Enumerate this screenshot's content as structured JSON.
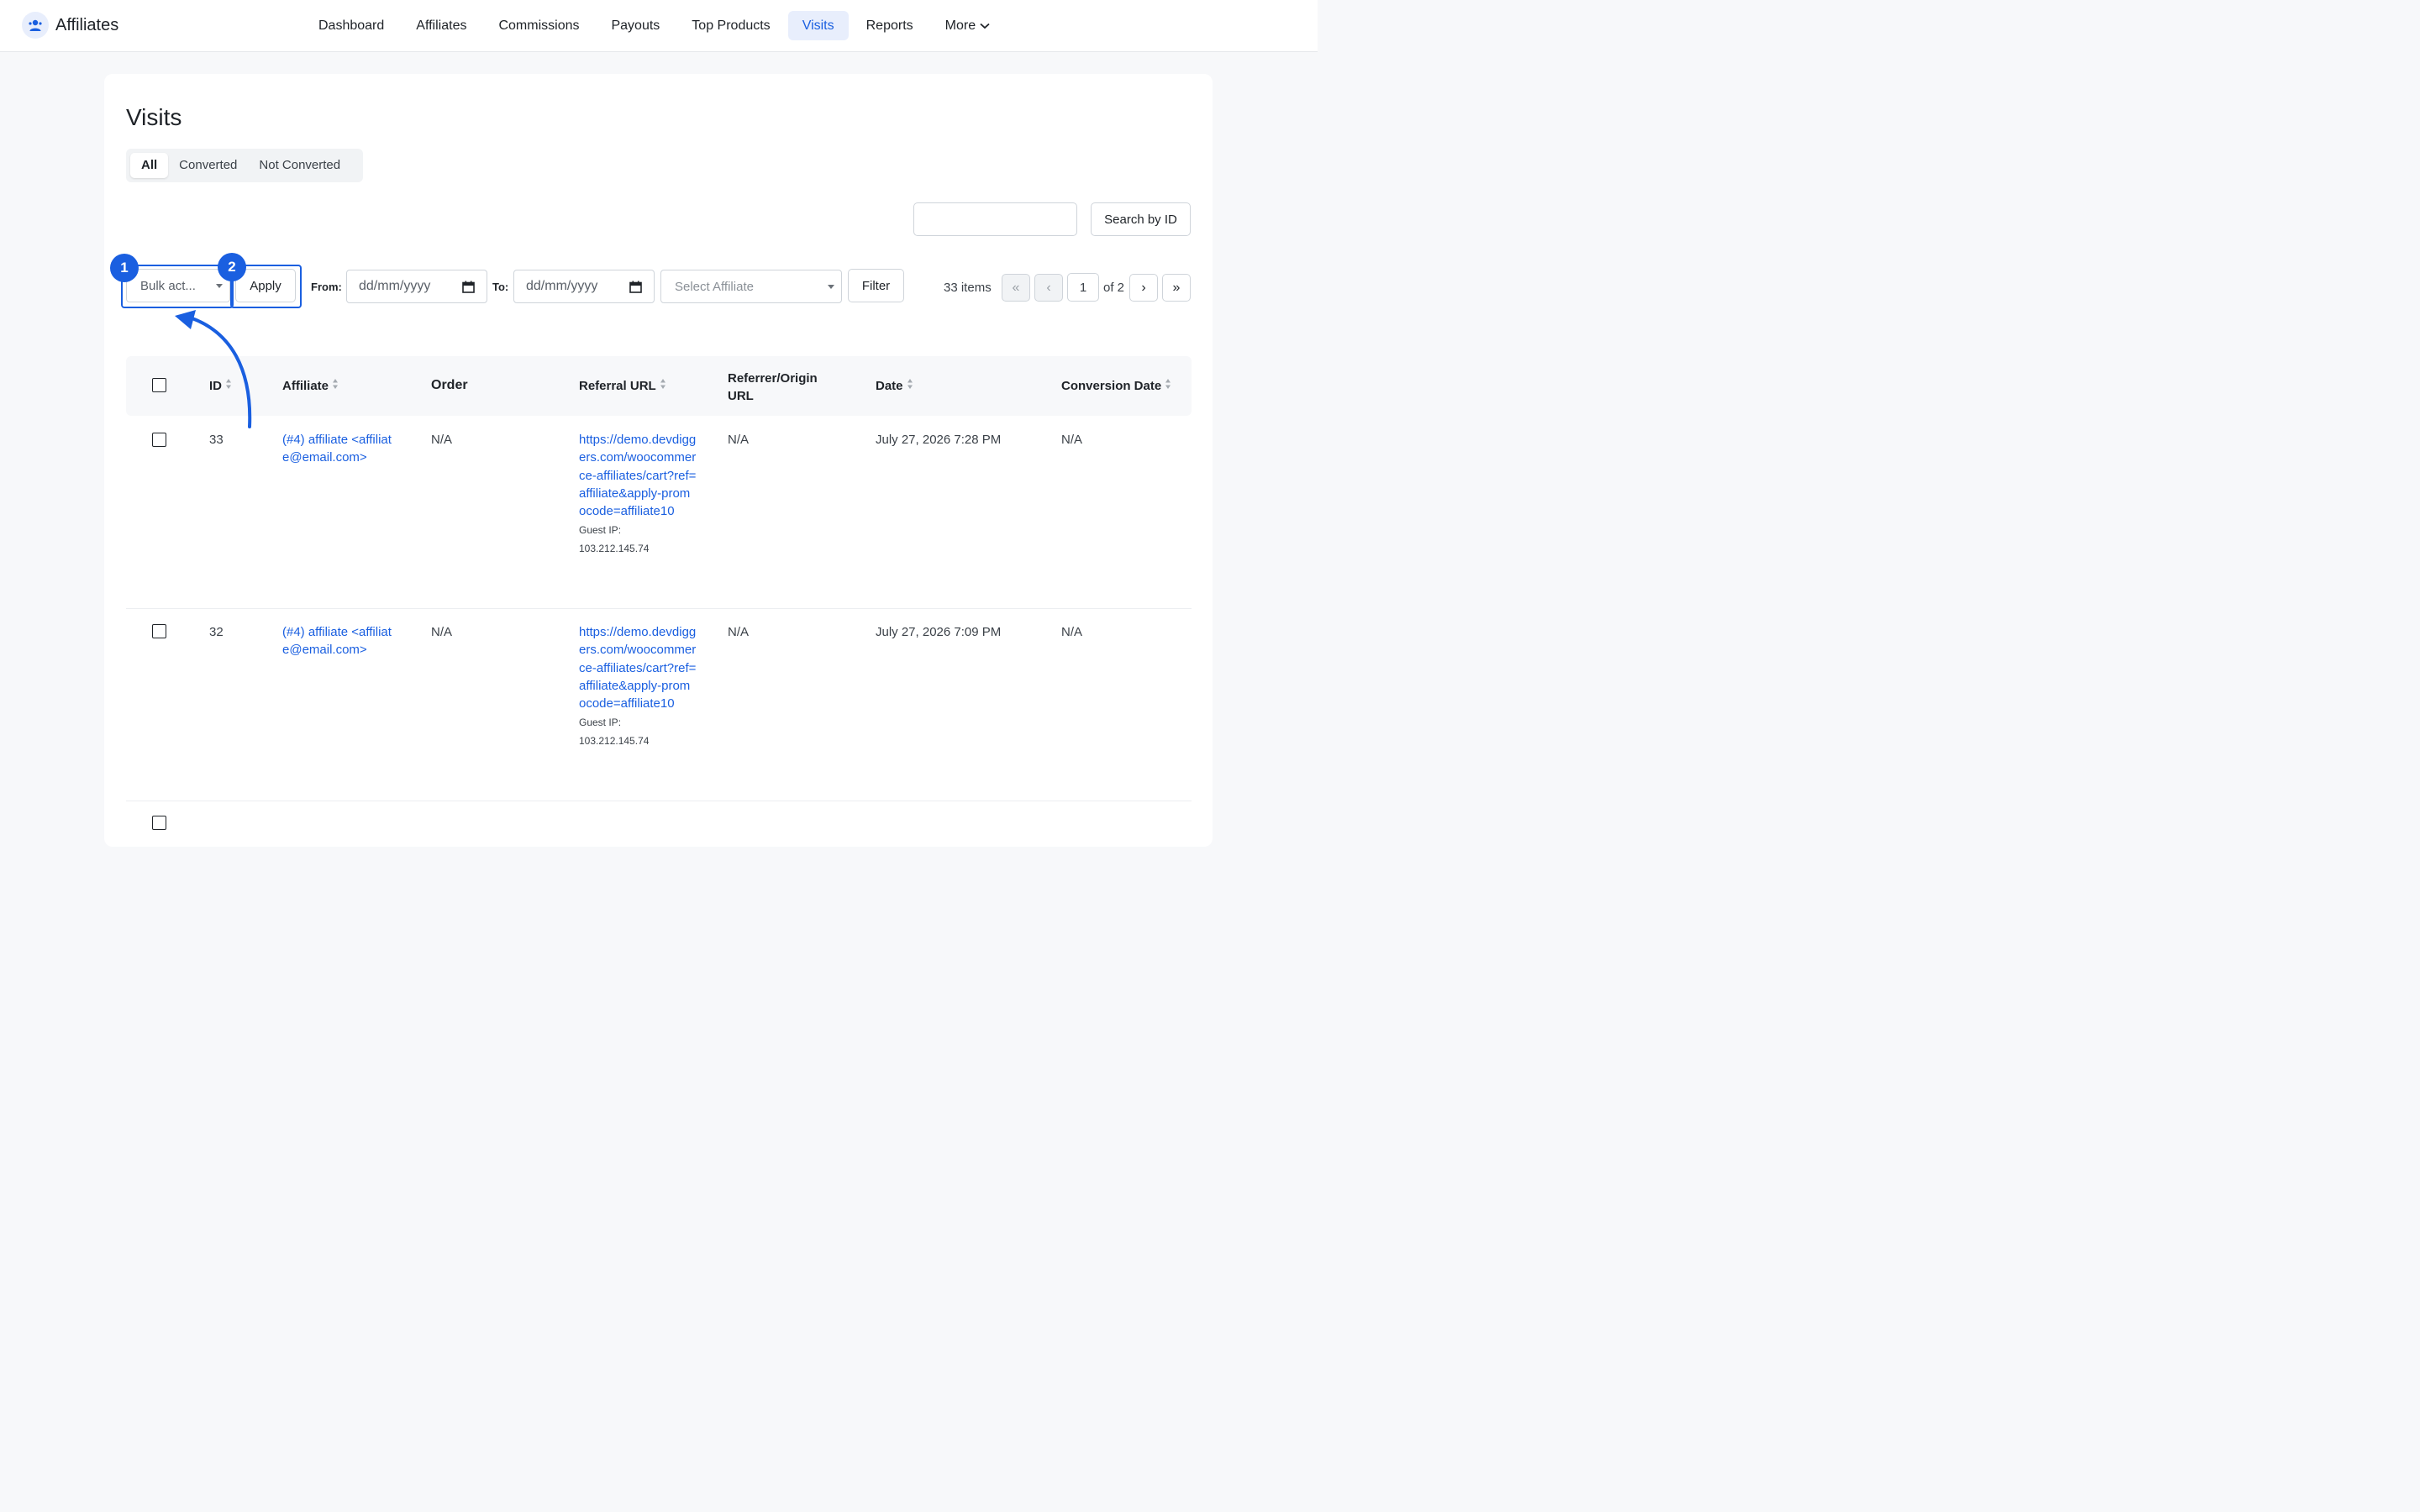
{
  "app": {
    "title": "Affiliates",
    "logo_icon": "affiliate-logo-icon"
  },
  "nav": {
    "items": [
      {
        "label": "Dashboard",
        "active": false
      },
      {
        "label": "Affiliates",
        "active": false
      },
      {
        "label": "Commissions",
        "active": false
      },
      {
        "label": "Payouts",
        "active": false
      },
      {
        "label": "Top Products",
        "active": false
      },
      {
        "label": "Visits",
        "active": true
      },
      {
        "label": "Reports",
        "active": false
      },
      {
        "label": "More",
        "active": false,
        "icon": "chevron-down-icon"
      }
    ]
  },
  "page": {
    "title": "Visits"
  },
  "tabs": [
    {
      "label": "All",
      "active": true
    },
    {
      "label": "Converted",
      "active": false
    },
    {
      "label": "Not Converted",
      "active": false
    }
  ],
  "search": {
    "value": "",
    "button_label": "Search by ID"
  },
  "toolbar": {
    "bulk_actions": {
      "selected": "Bulk act..."
    },
    "apply_label": "Apply",
    "from_label": "From:",
    "from_placeholder": "dd/mm/yyyy",
    "to_label": "To:",
    "to_placeholder": "dd/mm/yyyy",
    "affiliate_select": "Select Affiliate",
    "filter_label": "Filter"
  },
  "annotations": [
    {
      "number": "1",
      "target": "bulk-actions-select"
    },
    {
      "number": "2",
      "target": "apply-button"
    }
  ],
  "pagination": {
    "items_label": "33 items",
    "first": "«",
    "prev": "‹",
    "current_page": "1",
    "of_label": "of 2",
    "next": "›",
    "last": "»"
  },
  "table": {
    "columns": [
      "ID",
      "Affiliate",
      "Order",
      "Referral URL",
      "Referrer/Origin URL",
      "Date",
      "Conversion Date"
    ],
    "rows": [
      {
        "id": "33",
        "affiliate": "(#4) affiliate <affiliate@email.com>",
        "order": "N/A",
        "referral_url": "https://demo.devdiggers.com/woocommerce-affiliates/cart?ref=affiliate&apply-promocode=affiliate10",
        "guest_ip_label": "Guest IP:",
        "guest_ip": "103.212.145.74",
        "referrer": "N/A",
        "date": "July 27, 2026 7:28 PM",
        "conversion_date": "N/A"
      },
      {
        "id": "32",
        "affiliate": "(#4) affiliate <affiliate@email.com>",
        "order": "N/A",
        "referral_url": "https://demo.devdiggers.com/woocommerce-affiliates/cart?ref=affiliate&apply-promocode=affiliate10",
        "guest_ip_label": "Guest IP:",
        "guest_ip": "103.212.145.74",
        "referrer": "N/A",
        "date": "July 27, 2026 7:09 PM",
        "conversion_date": "N/A"
      }
    ]
  },
  "colors": {
    "accent": "#1a5fe0",
    "nav_active_bg": "#e8eefc"
  }
}
